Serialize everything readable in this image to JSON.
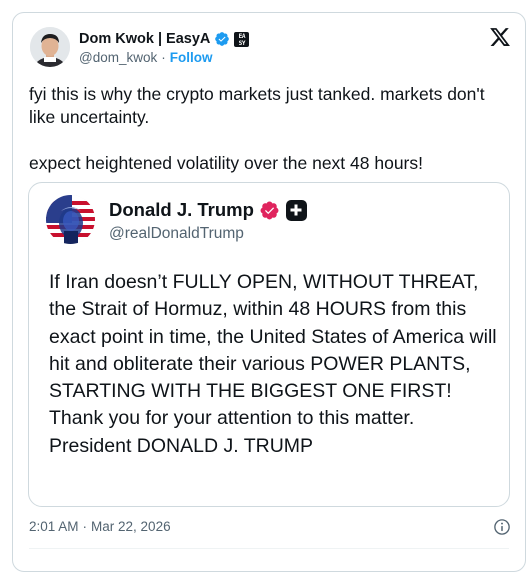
{
  "author": {
    "name": "Dom Kwok | EasyA",
    "handle": "@dom_kwok",
    "separator": "·",
    "follow_label": "Follow",
    "org_badge_text": "EASY A",
    "verified_color": "#1d9bf0"
  },
  "tweet": {
    "text": "fyi this is why the crypto markets just tanked. markets don't like uncertainty.\n\nexpect heightened volatility over the next 48 hours!"
  },
  "quoted_post": {
    "name": "Donald J. Trump",
    "handle": "@realDonaldTrump",
    "verified_color": "#e0245e",
    "text": "If Iran doesn’t FULLY OPEN, WITHOUT THREAT, the Strait of Hormuz, within 48 HOURS from this exact point in time, the United States of America will hit and obliterate their various POWER PLANTS, STARTING WITH THE BIGGEST ONE FIRST! Thank you for your attention to this matter. President DONALD J. TRUMP"
  },
  "footer": {
    "time": "2:01 AM",
    "separator": "·",
    "date": "Mar 22, 2026"
  },
  "icons": {
    "brand": "x-logo-icon",
    "info": "info-icon",
    "verified": "verified-badge-icon",
    "plus": "plus-badge-icon"
  },
  "colors": {
    "link": "#1d9bf0",
    "text_primary": "#0f1419",
    "text_secondary": "#536471",
    "border": "#cfd9de"
  }
}
